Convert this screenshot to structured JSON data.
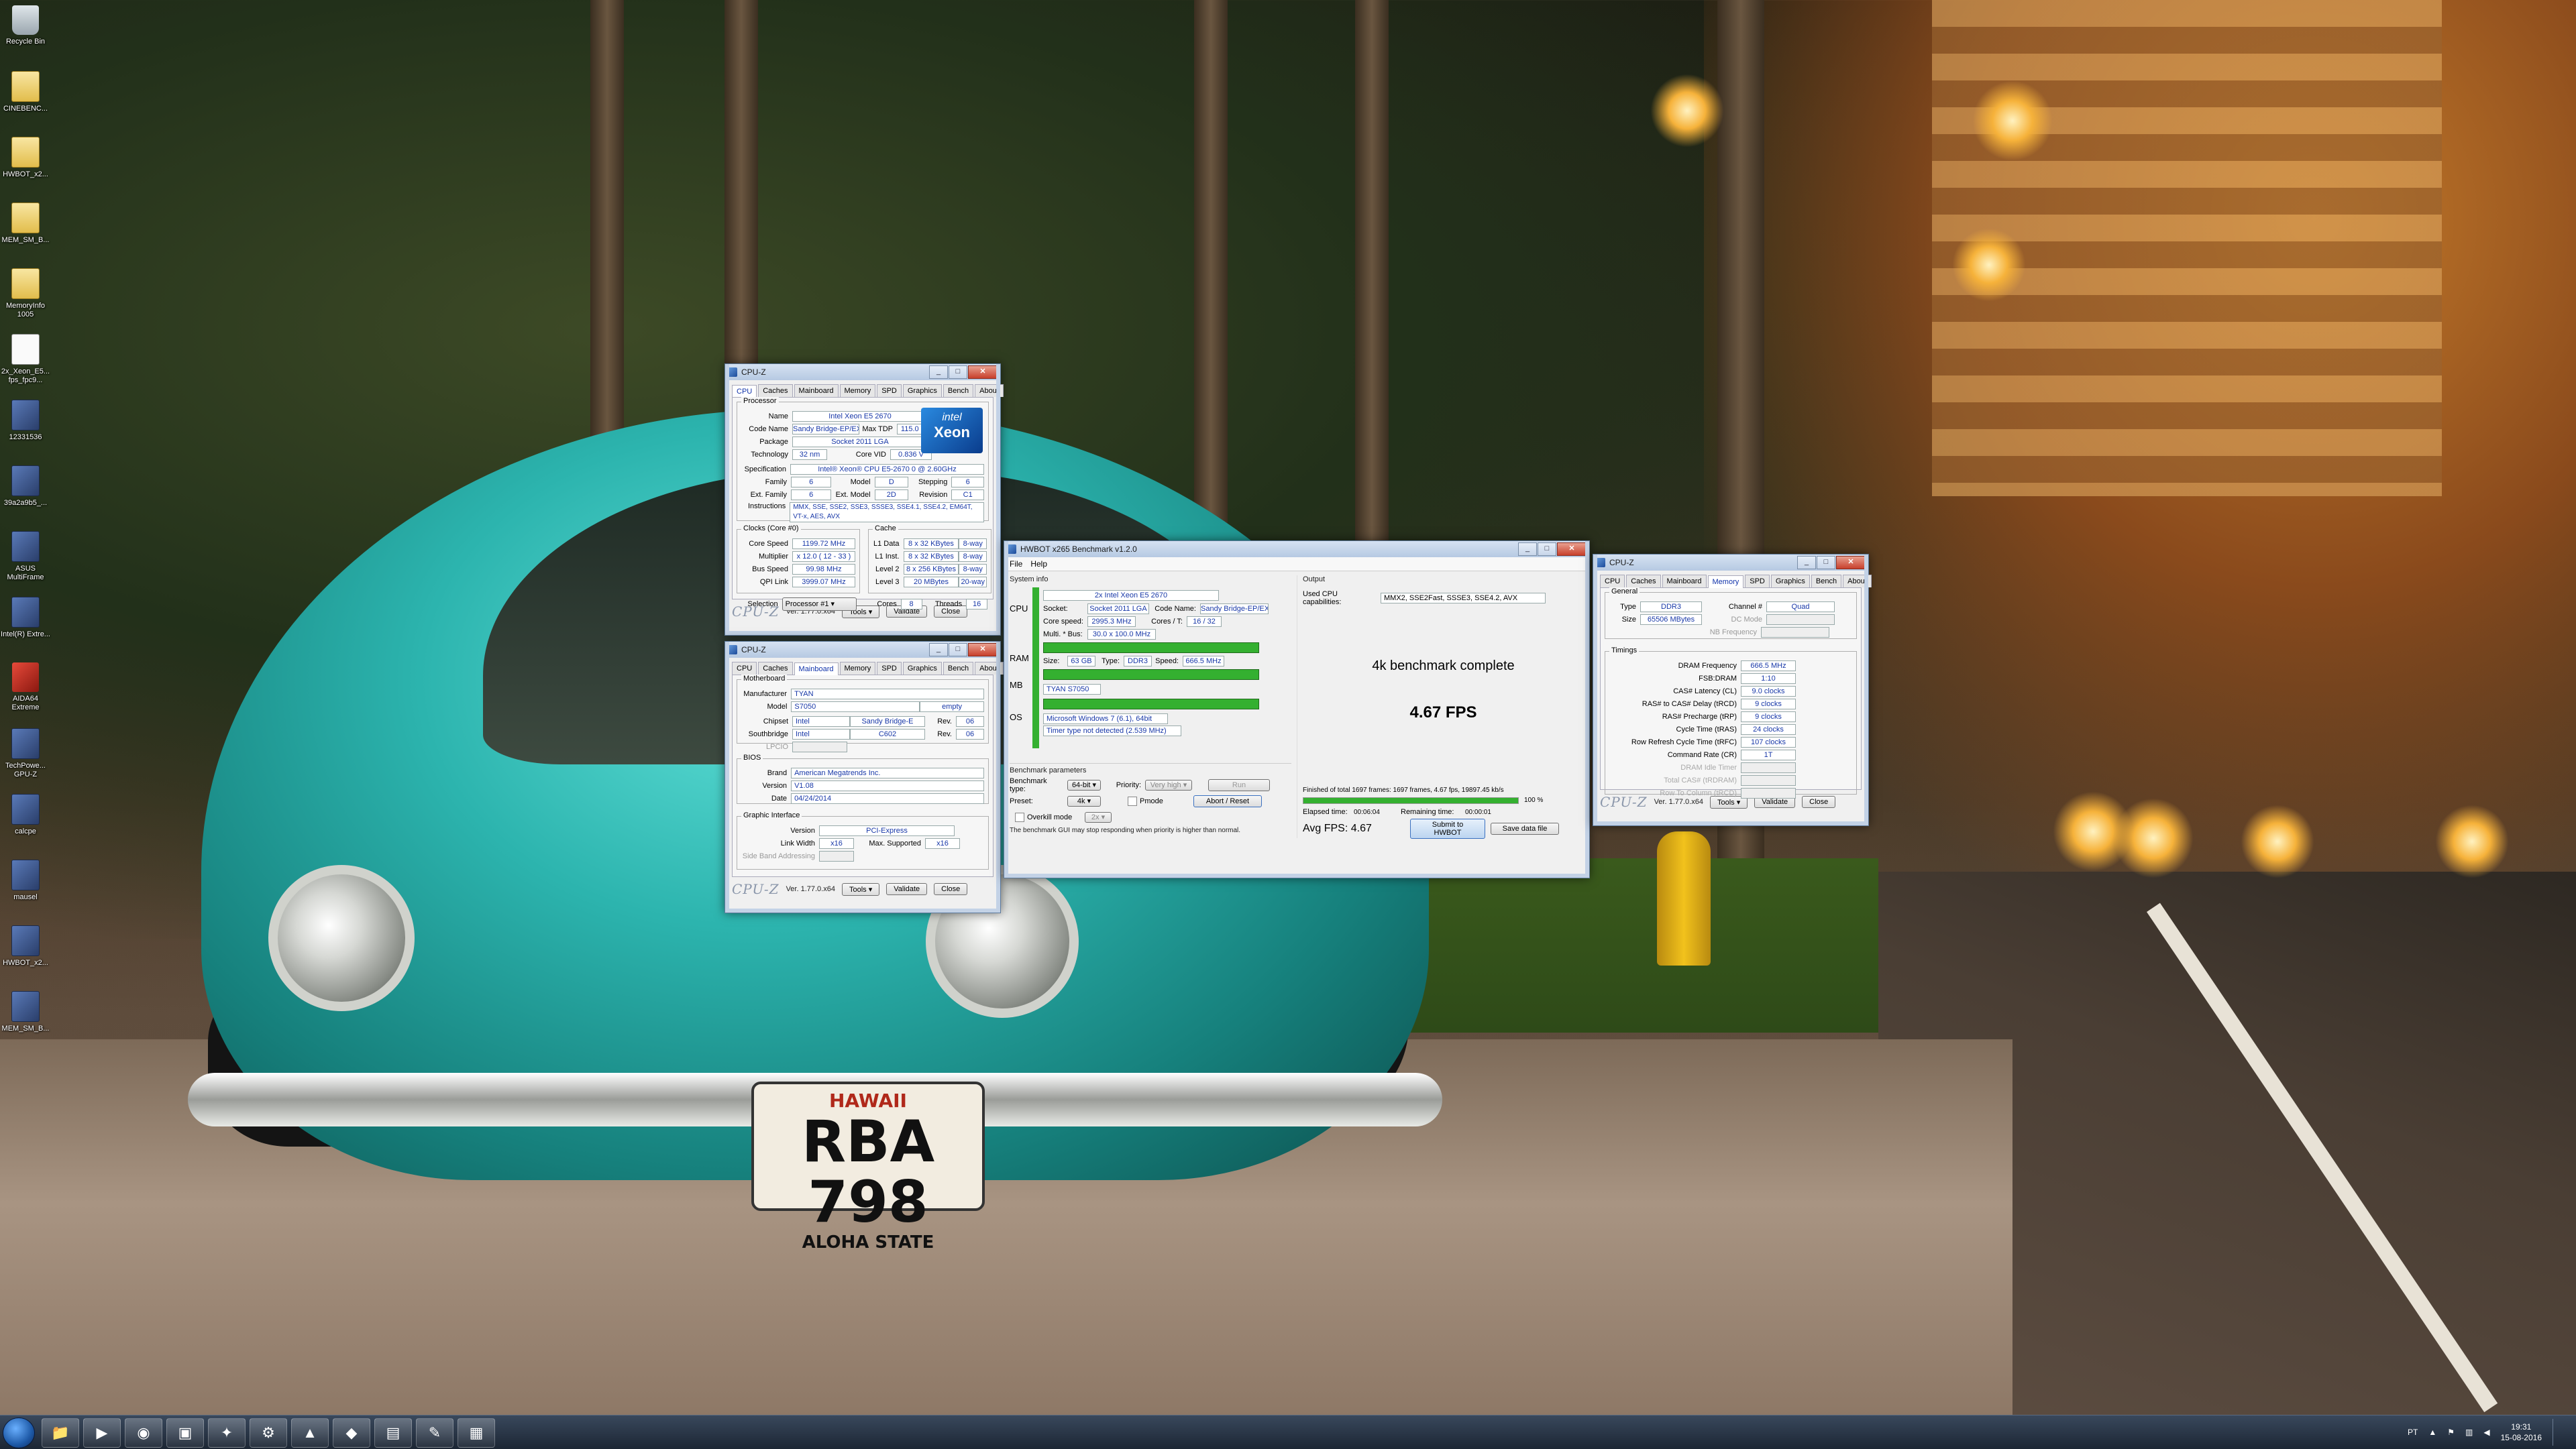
{
  "desktop": {
    "icons": [
      {
        "label": "Recycle Bin",
        "kind": "bin"
      },
      {
        "label": "CINEBENC...",
        "kind": "folder"
      },
      {
        "label": "HWBOT_x2...",
        "kind": "folder"
      },
      {
        "label": "MEM_SM_B...",
        "kind": "folder"
      },
      {
        "label": "MemoryInfo 1005",
        "kind": "folder"
      },
      {
        "label": "2x_Xeon_E5... fps_fpc9...",
        "kind": "file"
      },
      {
        "label": "12331536",
        "kind": "app"
      },
      {
        "label": "39a2a9b5_...",
        "kind": "app"
      },
      {
        "label": "ASUS MultiFrame",
        "kind": "app"
      },
      {
        "label": "Intel(R) Extre...",
        "kind": "app"
      },
      {
        "label": "AIDA64 Extreme",
        "kind": "red"
      },
      {
        "label": "TechPowe... GPU-Z",
        "kind": "app"
      },
      {
        "label": "calcpe",
        "kind": "app"
      },
      {
        "label": "mausel",
        "kind": "app"
      },
      {
        "label": "HWBOT_x2...",
        "kind": "app"
      },
      {
        "label": "MEM_SM_B...",
        "kind": "app"
      }
    ]
  },
  "wallpaper": {
    "plate_top": "HAWAII",
    "plate_number": "RBA 798",
    "plate_bottom": "ALOHA STATE"
  },
  "cpuz_cpu": {
    "title": "CPU-Z",
    "tabs": [
      "CPU",
      "Caches",
      "Mainboard",
      "Memory",
      "SPD",
      "Graphics",
      "Bench",
      "About"
    ],
    "active_tab": "CPU",
    "processor_group": "Processor",
    "name_label": "Name",
    "name": "Intel Xeon E5 2670",
    "codename_label": "Code Name",
    "codename": "Sandy Bridge-EP/EX",
    "maxtdp_label": "Max TDP",
    "maxtdp": "115.0 W",
    "package_label": "Package",
    "package": "Socket 2011 LGA",
    "technology_label": "Technology",
    "technology": "32 nm",
    "corevid_label": "Core VID",
    "corevid": "0.836 V",
    "spec_label": "Specification",
    "spec": "Intel® Xeon® CPU E5-2670 0 @ 2.60GHz",
    "family_label": "Family",
    "family": "6",
    "model_label": "Model",
    "model": "D",
    "stepping_label": "Stepping",
    "stepping": "6",
    "extfamily_label": "Ext. Family",
    "extfamily": "6",
    "extmodel_label": "Ext. Model",
    "extmodel": "2D",
    "revision_label": "Revision",
    "revision": "C1",
    "instructions_label": "Instructions",
    "instructions": "MMX, SSE, SSE2, SSE3, SSSE3, SSE4.1, SSE4.2, EM64T, VT-x, AES, AVX",
    "clocks_group": "Clocks (Core #0)",
    "corespeed_label": "Core Speed",
    "corespeed": "1199.72 MHz",
    "multiplier_label": "Multiplier",
    "multiplier": "x 12.0 ( 12 - 33 )",
    "busspeed_label": "Bus Speed",
    "busspeed": "99.98 MHz",
    "qpilink_label": "QPI Link",
    "qpilink": "3999.07 MHz",
    "cache_group": "Cache",
    "l1data_label": "L1 Data",
    "l1data": "8 x 32 KBytes",
    "l1data_way": "8-way",
    "l1inst_label": "L1 Inst.",
    "l1inst": "8 x 32 KBytes",
    "l1inst_way": "8-way",
    "l2_label": "Level 2",
    "l2": "8 x 256 KBytes",
    "l2_way": "8-way",
    "l3_label": "Level 3",
    "l3": "20 MBytes",
    "l3_way": "20-way",
    "selection_label": "Selection",
    "selection": "Processor #1",
    "cores_label": "Cores",
    "cores": "8",
    "threads_label": "Threads",
    "threads": "16",
    "badge_brand": "intel",
    "badge_model": "Xeon",
    "badge_sub": "inside",
    "logo": "CPU-Z",
    "version": "Ver. 1.77.0.x64",
    "tools": "Tools",
    "validate": "Validate",
    "close": "Close"
  },
  "cpuz_mb": {
    "title": "CPU-Z",
    "tabs": [
      "CPU",
      "Caches",
      "Mainboard",
      "Memory",
      "SPD",
      "Graphics",
      "Bench",
      "About"
    ],
    "active_tab": "Mainboard",
    "mb_group": "Motherboard",
    "manufacturer_label": "Manufacturer",
    "manufacturer": "TYAN",
    "model_label": "Model",
    "model": "S7050",
    "model_extra": "empty",
    "chipset_label": "Chipset",
    "chipset_vendor": "Intel",
    "chipset": "Sandy Bridge-E",
    "chipset_rev_label": "Rev.",
    "chipset_rev": "06",
    "southbridge_label": "Southbridge",
    "sb_vendor": "Intel",
    "sb": "C602",
    "sb_rev_label": "Rev.",
    "sb_rev": "06",
    "lpcio_label": "LPCIO",
    "bios_group": "BIOS",
    "brand_label": "Brand",
    "brand": "American Megatrends Inc.",
    "version_label": "Version",
    "bios_version": "V1.08",
    "date_label": "Date",
    "date": "04/24/2014",
    "gi_group": "Graphic Interface",
    "gi_version_label": "Version",
    "gi_version": "PCI-Express",
    "linkwidth_label": "Link Width",
    "linkwidth": "x16",
    "maxsupported_label": "Max. Supported",
    "maxsupported": "x16",
    "sideband_label": "Side Band Addressing",
    "logo": "CPU-Z",
    "version": "Ver. 1.77.0.x64",
    "tools": "Tools",
    "validate": "Validate",
    "close": "Close"
  },
  "cpuz_mem": {
    "title": "CPU-Z",
    "tabs": [
      "CPU",
      "Caches",
      "Mainboard",
      "Memory",
      "SPD",
      "Graphics",
      "Bench",
      "About"
    ],
    "active_tab": "Memory",
    "general_group": "General",
    "type_label": "Type",
    "type": "DDR3",
    "channel_label": "Channel #",
    "channel": "Quad",
    "size_label": "Size",
    "size": "65506 MBytes",
    "dcmode_label": "DC Mode",
    "nbfreq_label": "NB Frequency",
    "timings_group": "Timings",
    "timings": [
      {
        "label": "DRAM Frequency",
        "value": "666.5 MHz"
      },
      {
        "label": "FSB:DRAM",
        "value": "1:10"
      },
      {
        "label": "CAS# Latency (CL)",
        "value": "9.0 clocks"
      },
      {
        "label": "RAS# to CAS# Delay (tRCD)",
        "value": "9 clocks"
      },
      {
        "label": "RAS# Precharge (tRP)",
        "value": "9 clocks"
      },
      {
        "label": "Cycle Time (tRAS)",
        "value": "24 clocks"
      },
      {
        "label": "Row Refresh Cycle Time (tRFC)",
        "value": "107 clocks"
      },
      {
        "label": "Command Rate (CR)",
        "value": "1T"
      },
      {
        "label": "DRAM Idle Timer",
        "value": ""
      },
      {
        "label": "Total CAS# (tRDRAM)",
        "value": ""
      },
      {
        "label": "Row To Column (tRCD)",
        "value": ""
      }
    ],
    "logo": "CPU-Z",
    "version": "Ver. 1.77.0.x64",
    "tools": "Tools",
    "validate": "Validate",
    "close": "Close"
  },
  "hwbot": {
    "title": "HWBOT x265 Benchmark v1.2.0",
    "menu": [
      "File",
      "Help"
    ],
    "sysinfo_label": "System info",
    "cpu_label": "CPU",
    "ram_label": "RAM",
    "mb_label": "MB",
    "os_label": "OS",
    "cpu_name": "2x Intel Xeon E5 2670",
    "socket_label": "Socket:",
    "socket": "Socket 2011 LGA",
    "codename_label": "Code Name:",
    "codename": "Sandy Bridge-EP/EX",
    "corespeed_label": "Core speed:",
    "corespeed": "2995.3 MHz",
    "coresT_label": "Cores / T:",
    "coresT": "16 / 32",
    "multbus_label": "Multi. * Bus:",
    "multbus": "30.0 x 100.0 MHz",
    "ram_size_label": "Size:",
    "ram_size": "63 GB",
    "ram_type_label": "Type:",
    "ram_type": "DDR3",
    "ram_speed_label": "Speed:",
    "ram_speed": "666.5 MHz",
    "mb_name": "TYAN S7050",
    "os_name": "Microsoft Windows 7 (6.1), 64bit",
    "timer": "Timer type not detected (2.539 MHz)",
    "output_label": "Output",
    "capabilities_label": "Used CPU capabilities:",
    "capabilities": "MMX2, SSE2Fast, SSSE3, SSE4.2, AVX",
    "complete": "4k benchmark complete",
    "fps": "4.67 FPS",
    "params_label": "Benchmark parameters",
    "bench_type_label": "Benchmark type:",
    "bench_type": "64-bit",
    "priority_label": "Priority:",
    "priority": "Very high",
    "run": "Run",
    "preset_label": "Preset:",
    "preset": "4k",
    "pmode_label": "Pmode",
    "abort": "Abort / Reset",
    "overkill_label": "Overkill mode",
    "overkill": "2x",
    "finished": "Finished of total 1697 frames: 1697 frames, 4.67 fps,  19897.45 kb/s",
    "progress_pct": "100 %",
    "progress": 1.0,
    "elapsed_label": "Elapsed time:",
    "elapsed": "00:06:04",
    "remaining_label": "Remaining time:",
    "remaining": "00:00:01",
    "avg": "Avg FPS: 4.67",
    "submit": "Submit to HWBOT",
    "save": "Save data file",
    "warning": "The benchmark GUI may stop responding when priority is higher than normal."
  },
  "taskbar": {
    "lang": "PT",
    "time": "19:31",
    "date": "15-08-2016"
  }
}
